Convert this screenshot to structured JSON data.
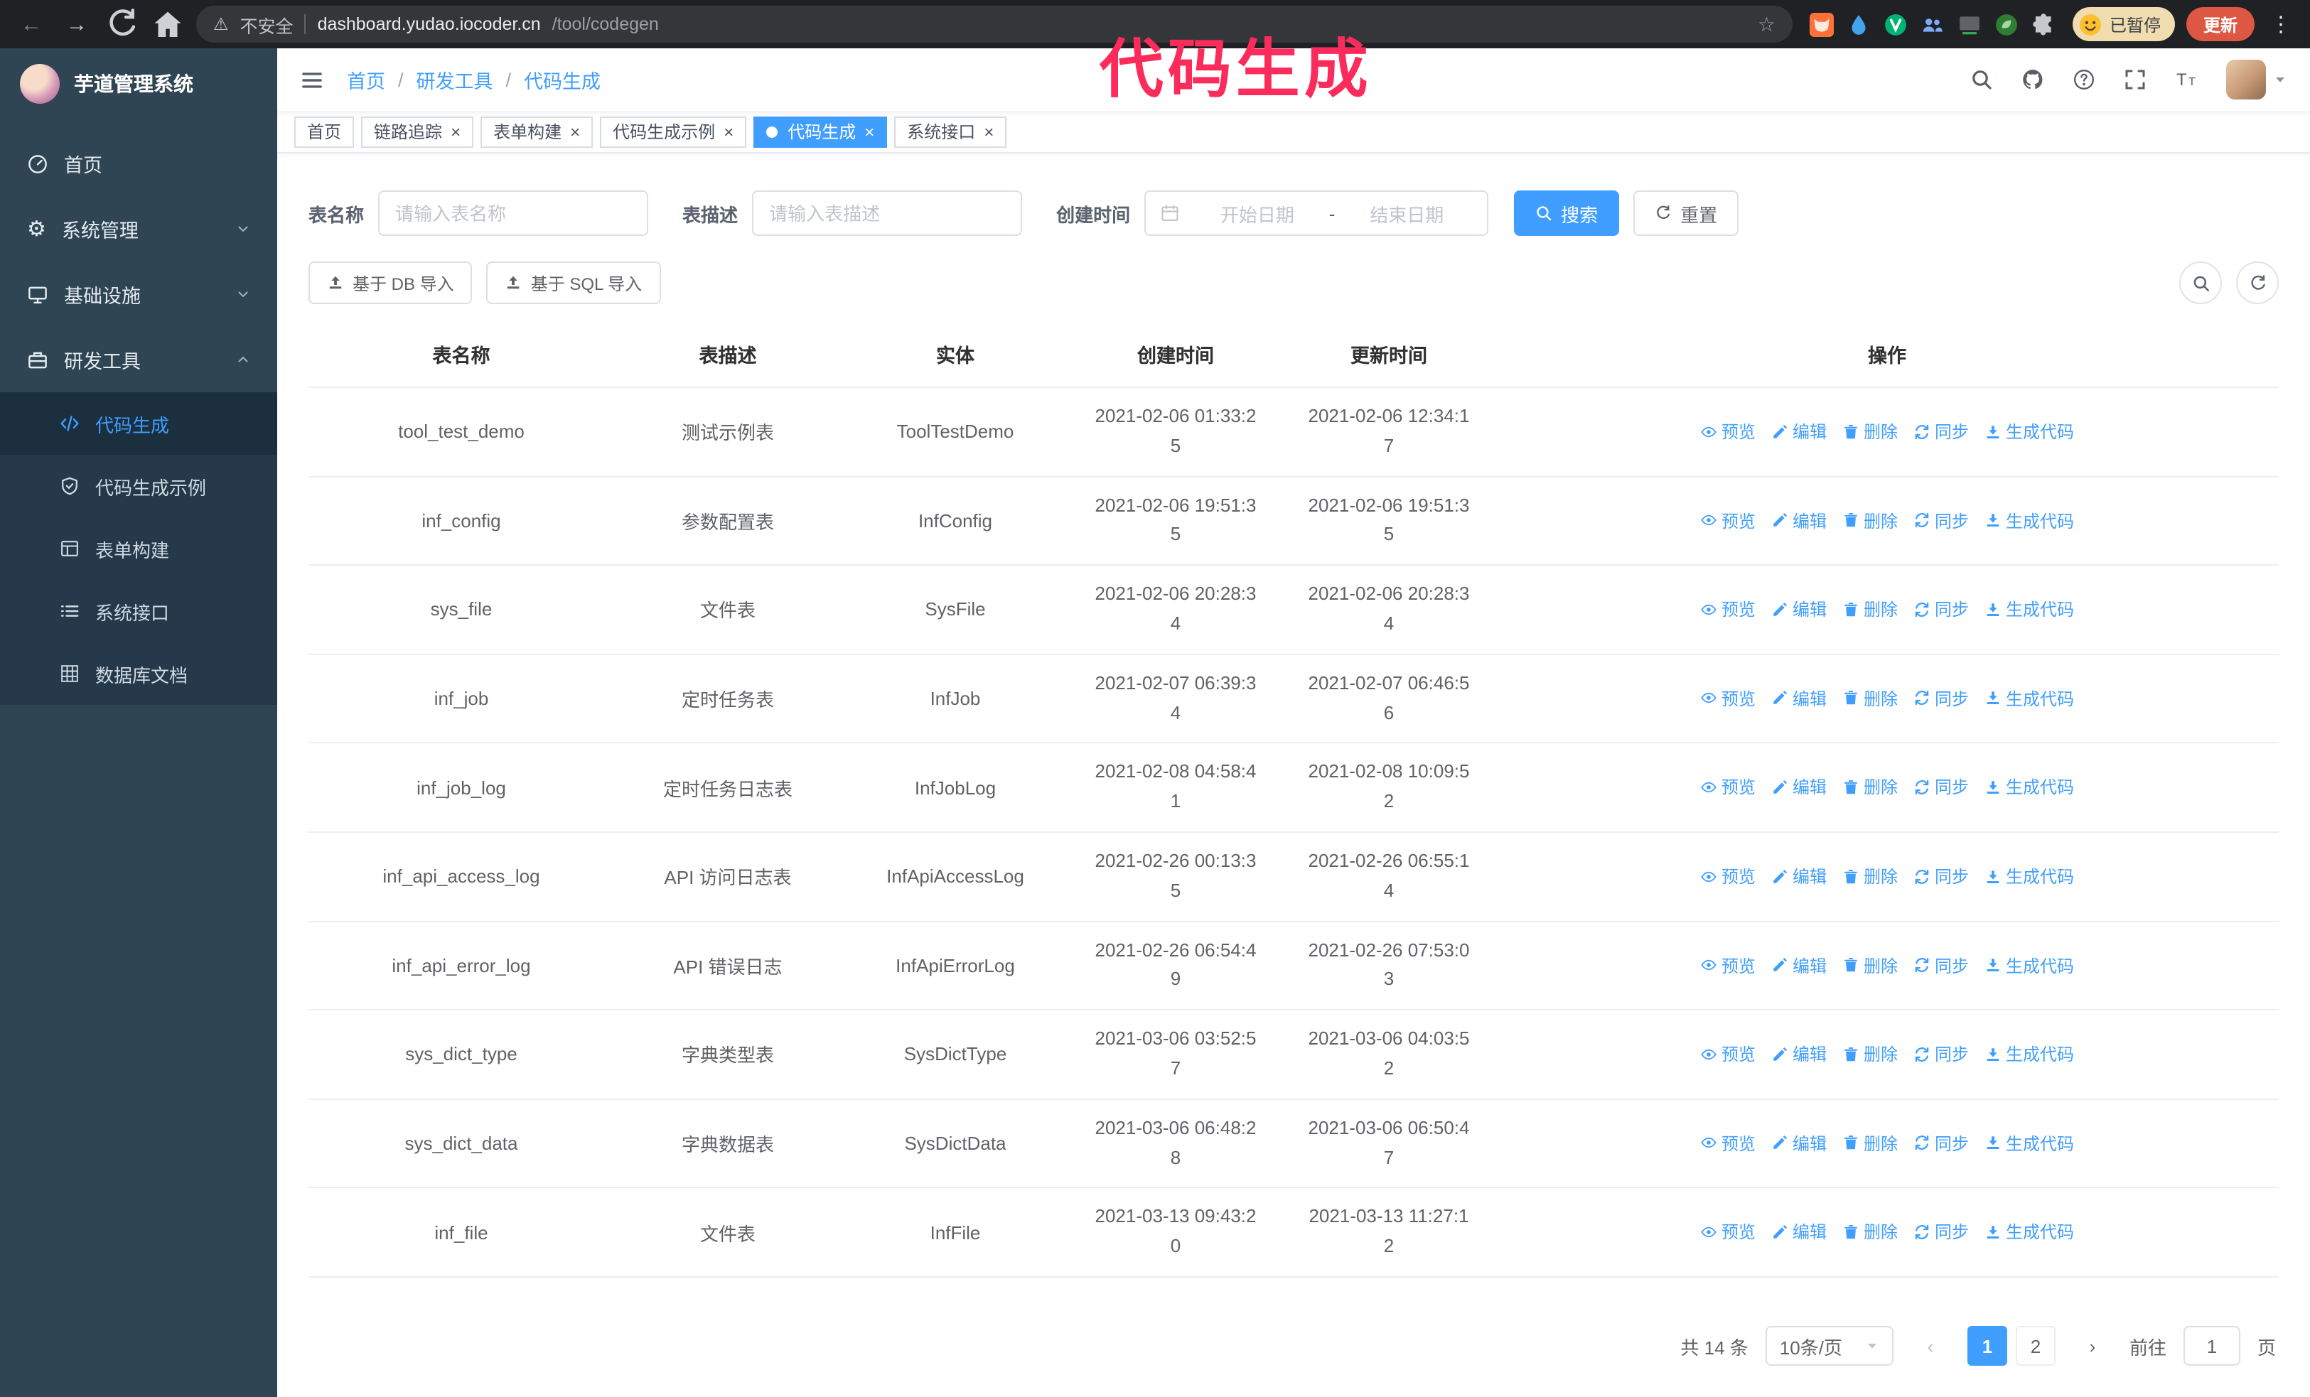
{
  "colors": {
    "accent": "#409eff",
    "sidebar_bg": "#2f4554",
    "submenu_bg": "#25394a",
    "annotation": "#fb2c5c",
    "chrome_bg": "#202124"
  },
  "annotation": "代码生成",
  "browser": {
    "security_label": "不安全",
    "url_domain": "dashboard.yudao.iocoder.cn",
    "url_path": "/tool/codegen",
    "profile_badge": "已暂停",
    "update_button": "更新"
  },
  "sidebar": {
    "logo_title": "芋道管理系统",
    "menu": [
      {
        "key": "home",
        "label": "首页",
        "icon": "dashboard"
      },
      {
        "key": "system",
        "label": "系统管理",
        "icon": "gear",
        "chevron": "down"
      },
      {
        "key": "infra",
        "label": "基础设施",
        "icon": "monitor",
        "chevron": "down"
      },
      {
        "key": "devtools",
        "label": "研发工具",
        "icon": "toolbox",
        "chevron": "up",
        "children": [
          {
            "key": "codegen",
            "label": "代码生成",
            "icon": "code",
            "active": true
          },
          {
            "key": "codegen-example",
            "label": "代码生成示例",
            "icon": "shield"
          },
          {
            "key": "form-builder",
            "label": "表单构建",
            "icon": "form"
          },
          {
            "key": "api",
            "label": "系统接口",
            "icon": "list"
          },
          {
            "key": "db-doc",
            "label": "数据库文档",
            "icon": "grid"
          }
        ]
      }
    ]
  },
  "header": {
    "breadcrumb": [
      "首页",
      "研发工具",
      "代码生成"
    ],
    "breadcrumb_separator": "/"
  },
  "tabs": [
    {
      "key": "home",
      "label": "首页",
      "closable": false,
      "active": false
    },
    {
      "key": "trace",
      "label": "链路追踪",
      "closable": true,
      "active": false
    },
    {
      "key": "form-builder",
      "label": "表单构建",
      "closable": true,
      "active": false
    },
    {
      "key": "codegen-example",
      "label": "代码生成示例",
      "closable": true,
      "active": false
    },
    {
      "key": "codegen",
      "label": "代码生成",
      "closable": true,
      "active": true
    },
    {
      "key": "api",
      "label": "系统接口",
      "closable": true,
      "active": false
    }
  ],
  "filters": {
    "table_name_label": "表名称",
    "table_name_placeholder": "请输入表名称",
    "table_desc_label": "表描述",
    "table_desc_placeholder": "请输入表描述",
    "create_time_label": "创建时间",
    "date_start_placeholder": "开始日期",
    "date_separator": "-",
    "date_end_placeholder": "结束日期",
    "search_button": "搜索",
    "reset_button": "重置"
  },
  "toolbar": {
    "import_db": "基于 DB 导入",
    "import_sql": "基于 SQL 导入"
  },
  "table": {
    "columns": [
      "表名称",
      "表描述",
      "实体",
      "创建时间",
      "更新时间",
      "操作"
    ],
    "row_actions": [
      {
        "label": "预览",
        "icon": "eye"
      },
      {
        "label": "编辑",
        "icon": "edit"
      },
      {
        "label": "删除",
        "icon": "delete"
      },
      {
        "label": "同步",
        "icon": "sync"
      },
      {
        "label": "生成代码",
        "icon": "download"
      }
    ],
    "rows": [
      {
        "name": "tool_test_demo",
        "desc": "测试示例表",
        "entity": "ToolTestDemo",
        "created": "2021-02-06 01:33:25",
        "updated": "2021-02-06 12:34:17"
      },
      {
        "name": "inf_config",
        "desc": "参数配置表",
        "entity": "InfConfig",
        "created": "2021-02-06 19:51:35",
        "updated": "2021-02-06 19:51:35"
      },
      {
        "name": "sys_file",
        "desc": "文件表",
        "entity": "SysFile",
        "created": "2021-02-06 20:28:34",
        "updated": "2021-02-06 20:28:34"
      },
      {
        "name": "inf_job",
        "desc": "定时任务表",
        "entity": "InfJob",
        "created": "2021-02-07 06:39:34",
        "updated": "2021-02-07 06:46:56"
      },
      {
        "name": "inf_job_log",
        "desc": "定时任务日志表",
        "entity": "InfJobLog",
        "created": "2021-02-08 04:58:41",
        "updated": "2021-02-08 10:09:52"
      },
      {
        "name": "inf_api_access_log",
        "desc": "API 访问日志表",
        "entity": "InfApiAccessLog",
        "created": "2021-02-26 00:13:35",
        "updated": "2021-02-26 06:55:14"
      },
      {
        "name": "inf_api_error_log",
        "desc": "API 错误日志",
        "entity": "InfApiErrorLog",
        "created": "2021-02-26 06:54:49",
        "updated": "2021-02-26 07:53:03"
      },
      {
        "name": "sys_dict_type",
        "desc": "字典类型表",
        "entity": "SysDictType",
        "created": "2021-03-06 03:52:57",
        "updated": "2021-03-06 04:03:52"
      },
      {
        "name": "sys_dict_data",
        "desc": "字典数据表",
        "entity": "SysDictData",
        "created": "2021-03-06 06:48:28",
        "updated": "2021-03-06 06:50:47"
      },
      {
        "name": "inf_file",
        "desc": "文件表",
        "entity": "InfFile",
        "created": "2021-03-13 09:43:20",
        "updated": "2021-03-13 11:27:12"
      }
    ]
  },
  "pagination": {
    "total": "共 14 条",
    "page_size": "10条/页",
    "prev": "‹",
    "next": "›",
    "pages": [
      "1",
      "2"
    ],
    "active_page": "1",
    "goto_label": "前往",
    "goto_value": "1",
    "goto_unit": "页"
  }
}
